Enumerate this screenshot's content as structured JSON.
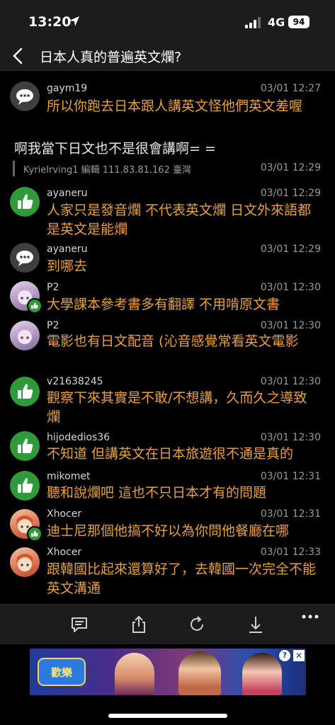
{
  "status_bar": {
    "time": "13:20",
    "network": "4G",
    "battery": "94"
  },
  "header": {
    "title": "日本人真的普遍英文爛?"
  },
  "op_reply": {
    "text": "啊我當下日文也不是很會講啊= ="
  },
  "edit_info": {
    "text": "KyrieIrving1 編輯 111.83.81.162 臺灣",
    "time": "03/01 12:29"
  },
  "comments": [
    {
      "user": "gaym19",
      "time": "03/01 12:27",
      "text": "所以你跑去日本跟人講英文怪他們英文差喔",
      "avatar": "speech-bubble-icon"
    },
    {
      "user": "ayaneru",
      "time": "03/01 12:29",
      "text": "人家只是發音爛 不代表英文爛 日文外來語都是英文是能爛",
      "avatar": "thumbs-up-icon"
    },
    {
      "user": "ayaneru",
      "time": "03/01 12:29",
      "text": "到哪去",
      "avatar": "speech-bubble-icon"
    },
    {
      "user": "P2",
      "time": "03/01 12:30",
      "text": "大學課本參考書多有翻譯 不用啃原文書",
      "avatar": "anime-avatar"
    },
    {
      "user": "P2",
      "time": "03/01 12:30",
      "text": "電影也有日文配音 (沁音感覺常看英文電影",
      "avatar": "anime-avatar"
    },
    {
      "user": "v21638245",
      "time": "03/01 12:30",
      "text": "觀察下來其實是不敢/不想講，久而久之導致爛",
      "avatar": "thumbs-up-icon"
    },
    {
      "user": "hijodedios36",
      "time": "03/01 12:30",
      "text": "不知道 但講英文在日本旅遊很不通是真的",
      "avatar": "thumbs-up-icon"
    },
    {
      "user": "mikomet",
      "time": "03/01 12:31",
      "text": "聽和說爛吧 這也不只日本才有的問題",
      "avatar": "thumbs-up-icon"
    },
    {
      "user": "Xhocer",
      "time": "03/01 12:31",
      "text": "迪士尼那個他搞不好以為你問他餐廳在哪",
      "avatar": "cartoon-avatar"
    },
    {
      "user": "Xhocer",
      "time": "03/01 12:33",
      "text": "跟韓國比起來還算好了，去韓國一次完全不能英文溝通",
      "avatar": "cartoon-avatar"
    }
  ],
  "toolbar": {
    "icons": [
      "comment-icon",
      "share-icon",
      "refresh-icon",
      "download-icon",
      "more-icon"
    ]
  },
  "ad": {
    "logo_text": "歡樂",
    "icons": [
      "info-icon",
      "close-icon"
    ]
  },
  "colors": {
    "comment_text": "#e8a13a",
    "background": "#000000",
    "bar": "#1c1c1e",
    "accent_green": "#2e9a3a"
  }
}
